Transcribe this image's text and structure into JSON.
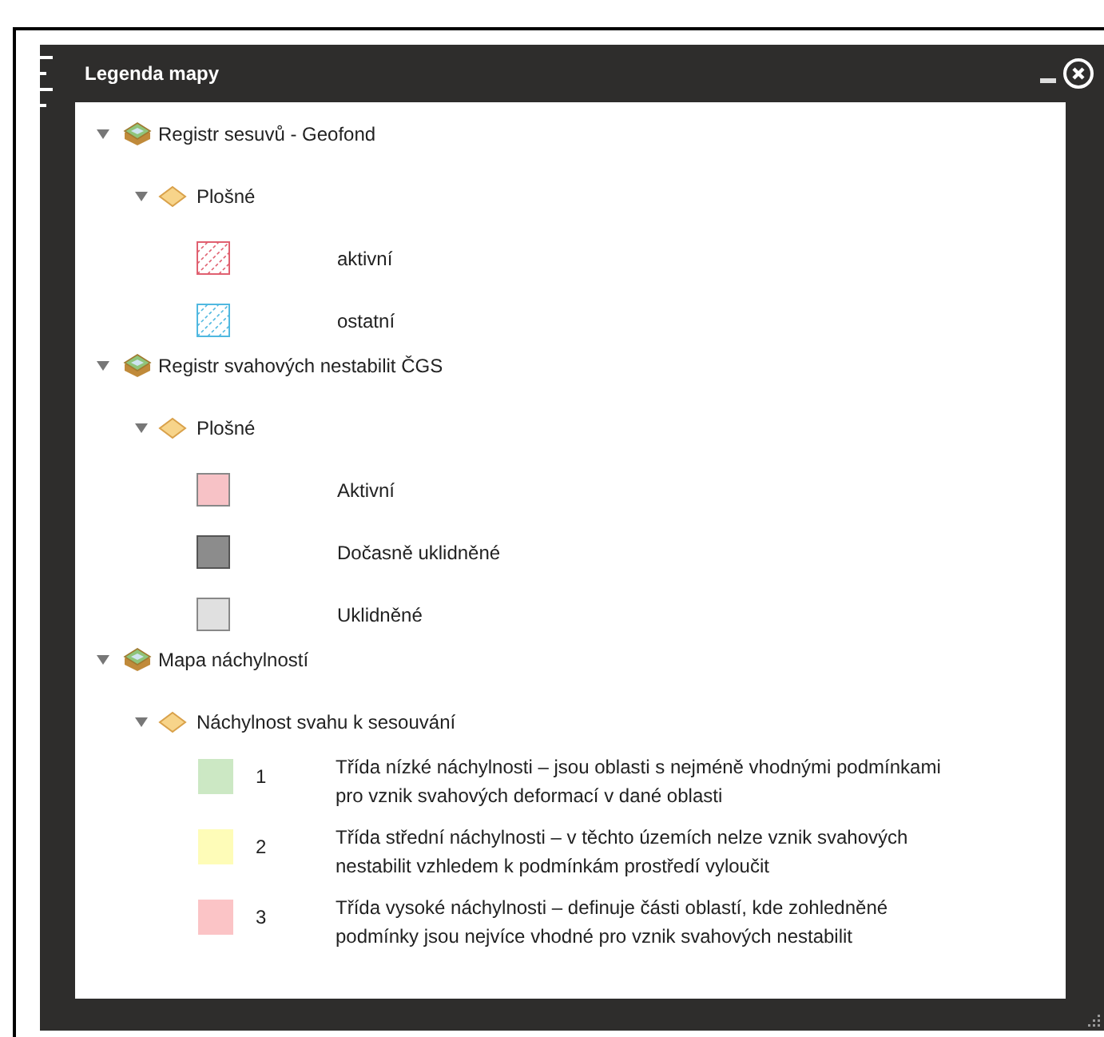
{
  "window": {
    "title": "Legenda mapy"
  },
  "layers": [
    {
      "label": "Registr sesuvů - Geofond",
      "expanded": true,
      "sublayers": [
        {
          "label": "Plošné",
          "expanded": true,
          "items": [
            {
              "kind": "hatch",
              "color": "#e06070",
              "label": "aktivní"
            },
            {
              "kind": "hatch",
              "color": "#50b8e0",
              "label": "ostatní"
            }
          ]
        }
      ]
    },
    {
      "label": "Registr svahových nestabilit ČGS",
      "expanded": true,
      "sublayers": [
        {
          "label": "Plošné",
          "expanded": true,
          "items": [
            {
              "kind": "fill",
              "color": "#f7c2c6",
              "label": "Aktivní"
            },
            {
              "kind": "fill",
              "color": "#8c8c8c",
              "label": "Dočasně uklidněné"
            },
            {
              "kind": "fill",
              "color": "#e0e0e0",
              "label": "Uklidněné"
            }
          ]
        }
      ]
    },
    {
      "label": "Mapa náchylností",
      "expanded": true,
      "sublayers": [
        {
          "label": "Náchylnost svahu k sesouvání",
          "expanded": true,
          "items": [
            {
              "kind": "numbered",
              "color": "#cce8c4",
              "number": "1",
              "label": "Třída nízké náchylnosti – jsou oblasti s nejméně vhodnými podmínkami pro vznik svahových deformací v dané oblasti"
            },
            {
              "kind": "numbered",
              "color": "#fefcb8",
              "number": "2",
              "label": "Třída střední náchylnosti – v těchto územích nelze vznik svahových nestabilit vzhledem k podmínkám prostředí vyloučit"
            },
            {
              "kind": "numbered",
              "color": "#fbc4c6",
              "number": "3",
              "label": "Třída vysoké náchylnosti – definuje části oblastí, kde zohledněné podmínky jsou nejvíce vhodné pro vznik svahových nestabilit"
            }
          ]
        }
      ]
    }
  ]
}
